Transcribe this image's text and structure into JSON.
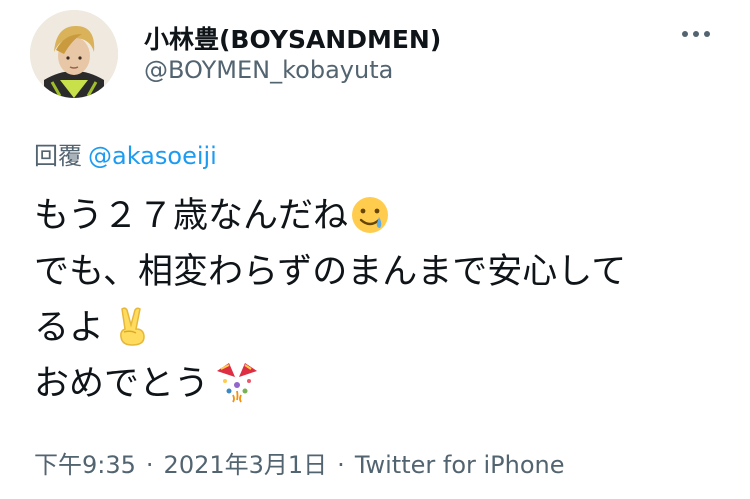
{
  "author": {
    "display_name": "小林豊(BOYSANDMEN)",
    "handle": "@BOYMEN_kobayuta"
  },
  "reply": {
    "label": "回覆",
    "mention": "@akasoeiji"
  },
  "body": {
    "lines": [
      "もう２７歳なんだね",
      "でも、相変わらずのまんまで安心して",
      "るよ",
      "おめでとう"
    ],
    "emojis": [
      "smiling-face-with-tear-icon",
      "victory-hand-icon",
      "party-popper-icon"
    ]
  },
  "meta": {
    "time": "下午9:35",
    "separator": "·",
    "date": "2021年3月1日",
    "source": "Twitter for iPhone"
  },
  "colors": {
    "text": "#0f1419",
    "secondary": "#536471",
    "link": "#1d9bf0",
    "background": "#ffffff"
  }
}
